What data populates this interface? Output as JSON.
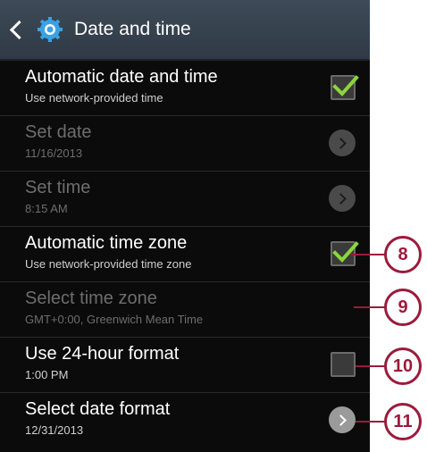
{
  "header": {
    "title": "Date and time",
    "back_icon": "chevron-left-icon",
    "app_icon": "gear-icon"
  },
  "settings": [
    {
      "title": "Automatic date and time",
      "subtitle": "Use network-provided time",
      "control": "checkbox",
      "checked": true,
      "enabled": true
    },
    {
      "title": "Set date",
      "subtitle": "11/16/2013",
      "control": "arrow",
      "enabled": false
    },
    {
      "title": "Set time",
      "subtitle": "8:15 AM",
      "control": "arrow",
      "enabled": false
    },
    {
      "title": "Automatic time zone",
      "subtitle": "Use network-provided time zone",
      "control": "checkbox",
      "checked": true,
      "enabled": true
    },
    {
      "title": "Select time zone",
      "subtitle": "GMT+0:00, Greenwich Mean Time",
      "control": "none",
      "enabled": false
    },
    {
      "title": "Use 24-hour format",
      "subtitle": "1:00 PM",
      "control": "checkbox",
      "checked": false,
      "enabled": true
    },
    {
      "title": "Select date format",
      "subtitle": "12/31/2013",
      "control": "arrow",
      "enabled": true
    }
  ],
  "callouts": [
    "8",
    "9",
    "10",
    "11"
  ],
  "colors": {
    "action_bar": "#35414d",
    "check_green": "#8cd53b",
    "callout": "#9b1b3c",
    "background": "#0b0b0b"
  }
}
